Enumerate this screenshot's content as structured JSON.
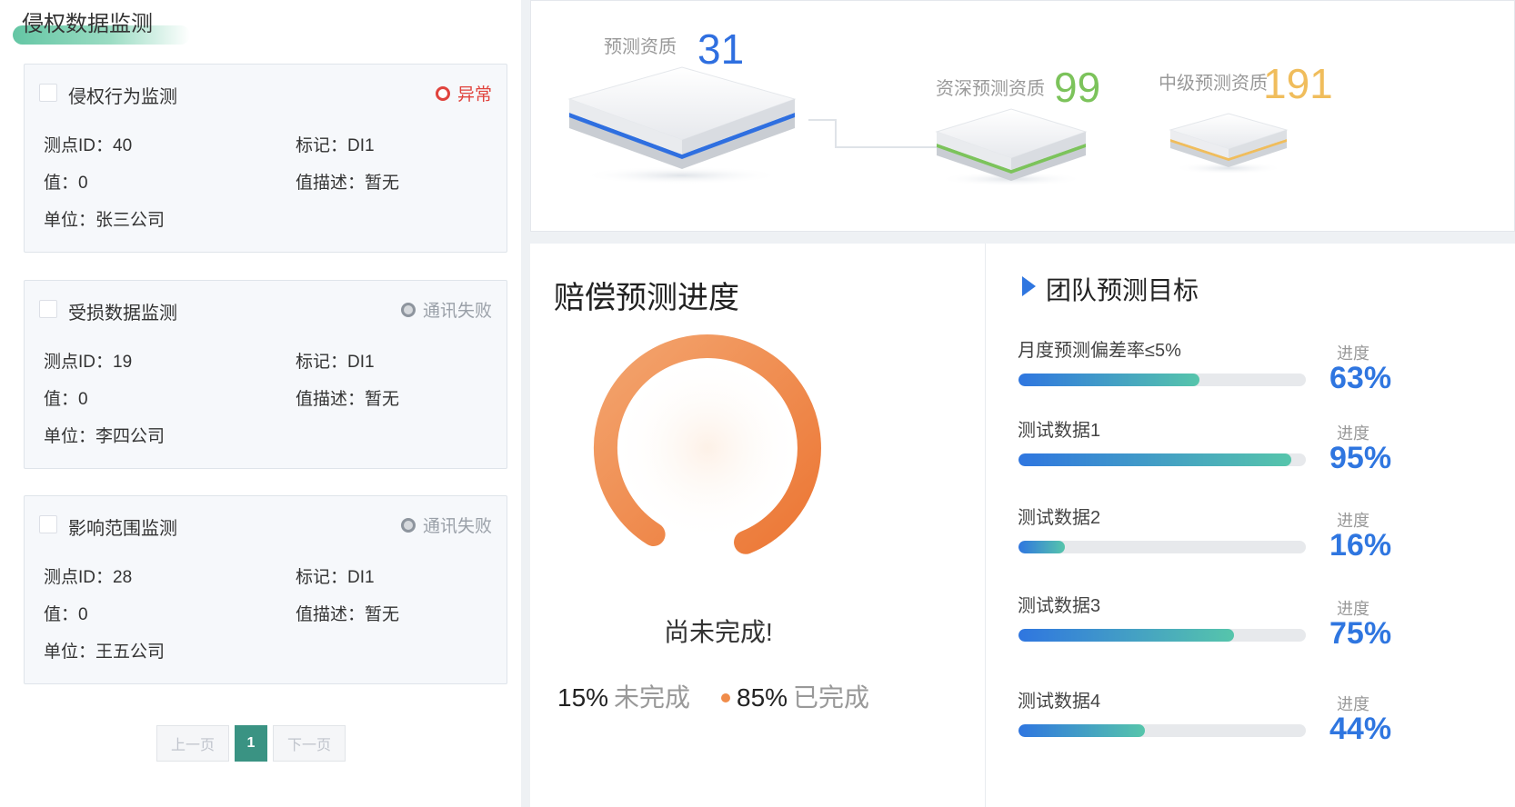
{
  "left": {
    "title": "侵权数据监测",
    "cards": [
      {
        "title": "侵权行为监测",
        "status": "异常",
        "status_type": "abnormal",
        "id_label": "测点ID：40",
        "mark_label": "标记：DI1",
        "value_label": "值：0",
        "desc_label": "值描述：暂无",
        "unit_label": "单位：张三公司"
      },
      {
        "title": "受损数据监测",
        "status": "通讯失败",
        "status_type": "fail",
        "id_label": "测点ID：19",
        "mark_label": "标记：DI1",
        "value_label": "值：0",
        "desc_label": "值描述：暂无",
        "unit_label": "单位：李四公司"
      },
      {
        "title": "影响范围监测",
        "status": "通讯失败",
        "status_type": "fail",
        "id_label": "测点ID：28",
        "mark_label": "标记：DI1",
        "value_label": "值：0",
        "desc_label": "值描述：暂无",
        "unit_label": "单位：王五公司"
      }
    ],
    "pagination": {
      "prev": "上一页",
      "current": "1",
      "next": "下一页"
    }
  },
  "stats": [
    {
      "label": "预测资质",
      "value": "31",
      "color": "#2f6fe0"
    },
    {
      "label": "资深预测资质",
      "value": "99",
      "color": "#7cc35b"
    },
    {
      "label": "中级预测资质",
      "value": "191",
      "color": "#f0bd5c"
    }
  ],
  "progress": {
    "title": "赔偿预测进度",
    "status_text": "尚未完成!",
    "incomplete_pct": "15%",
    "incomplete_label": "未完成",
    "complete_pct": "85%",
    "complete_label": "已完成",
    "complete_fraction": 0.85,
    "ring_color": "#ef7f3d"
  },
  "goals": {
    "title": "团队预测目标",
    "progress_label": "进度",
    "items": [
      {
        "name": "月度预测偏差率≤5%",
        "pct": "63%",
        "fraction": 0.63
      },
      {
        "name": "测试数据1",
        "pct": "95%",
        "fraction": 0.95
      },
      {
        "name": "测试数据2",
        "pct": "16%",
        "fraction": 0.16
      },
      {
        "name": "测试数据3",
        "pct": "75%",
        "fraction": 0.75
      },
      {
        "name": "测试数据4",
        "pct": "44%",
        "fraction": 0.44
      }
    ]
  }
}
